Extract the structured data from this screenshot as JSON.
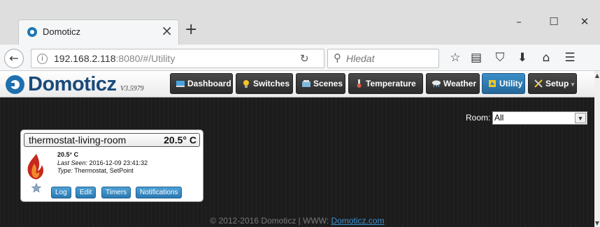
{
  "browser": {
    "tab_title": "Domoticz",
    "tab_close": "×",
    "new_tab": "+",
    "window_controls": [
      "–",
      "☐",
      "✕"
    ],
    "back": "←",
    "url_host": "192.168.2.118",
    "url_rest": ":8080/#/Utility",
    "search_placeholder": "Hledat",
    "toolbar_icons": [
      "star-icon",
      "reading-list-icon",
      "pocket-icon",
      "download-icon",
      "home-icon",
      "menu-icon"
    ]
  },
  "app": {
    "logo_text": "Domoticz",
    "version": "V3.5979",
    "menu": [
      {
        "label": "Dashboard",
        "icon": "dashboard-icon",
        "active": false
      },
      {
        "label": "Switches",
        "icon": "bulb-icon",
        "active": false
      },
      {
        "label": "Scenes",
        "icon": "scenes-icon",
        "active": false
      },
      {
        "label": "Temperature",
        "icon": "thermometer-icon",
        "active": false
      },
      {
        "label": "Weather",
        "icon": "weather-icon",
        "active": false
      },
      {
        "label": "Utility",
        "icon": "utility-icon",
        "active": true
      },
      {
        "label": "Setup",
        "icon": "tools-icon",
        "active": false,
        "dropdown": "▾"
      }
    ]
  },
  "filter": {
    "room_label": "Room:",
    "room_value": "All"
  },
  "device": {
    "name": "thermostat-living-room",
    "value": "20.5° C",
    "line1": "20.5° C",
    "last_seen_label": "Last Seen:",
    "last_seen": "2016-12-09 23:41:32",
    "type_label": "Type:",
    "type_value": "Thermostat, SetPoint",
    "buttons": {
      "log": "Log",
      "edit": "Edit",
      "timers": "Timers",
      "notifications": "Notifications"
    }
  },
  "footer": {
    "text": "© 2012-2016 Domoticz | WWW: ",
    "link": "Domoticz.com"
  },
  "colors": {
    "brand_blue": "#1e6fad",
    "menu_active": "#2f82bd",
    "button_blue": "#3a8fc9"
  }
}
